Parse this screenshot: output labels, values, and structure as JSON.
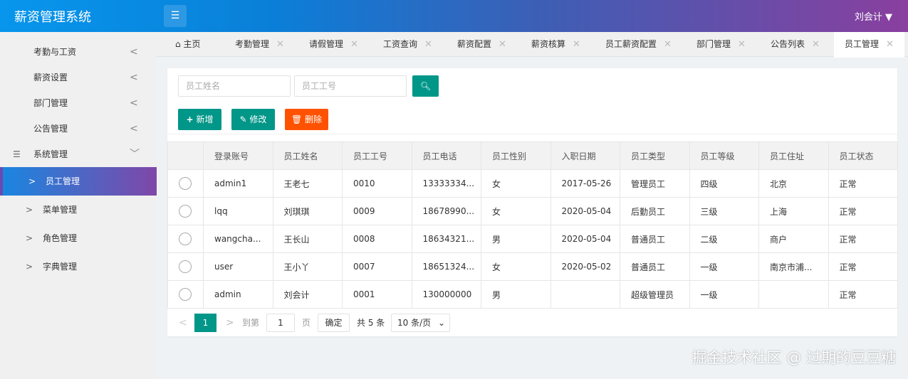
{
  "header": {
    "title": "薪资管理系统",
    "user": "刘会计"
  },
  "sidebar": {
    "items": [
      {
        "label": "考勤与工资"
      },
      {
        "label": "薪资设置"
      },
      {
        "label": "部门管理"
      },
      {
        "label": "公告管理"
      },
      {
        "label": "系统管理"
      }
    ],
    "sub": [
      {
        "label": "员工管理",
        "active": true
      },
      {
        "label": "菜单管理"
      },
      {
        "label": "角色管理"
      },
      {
        "label": "字典管理"
      }
    ]
  },
  "tabs": [
    {
      "label": "主页"
    },
    {
      "label": "考勤管理"
    },
    {
      "label": "请假管理"
    },
    {
      "label": "工资查询"
    },
    {
      "label": "薪资配置"
    },
    {
      "label": "薪资核算"
    },
    {
      "label": "员工薪资配置"
    },
    {
      "label": "部门管理"
    },
    {
      "label": "公告列表"
    },
    {
      "label": "员工管理",
      "active": true
    }
  ],
  "search": {
    "name_placeholder": "员工姓名",
    "id_placeholder": "员工工号"
  },
  "toolbar": {
    "add": "新增",
    "edit": "修改",
    "delete": "删除"
  },
  "table": {
    "headers": [
      "登录账号",
      "员工姓名",
      "员工工号",
      "员工电话",
      "员工性别",
      "入职日期",
      "员工类型",
      "员工等级",
      "员工住址",
      "员工状态"
    ],
    "rows": [
      [
        "admin1",
        "王老七",
        "0010",
        "13333334...",
        "女",
        "2017-05-26",
        "管理员工",
        "四级",
        "北京",
        "正常"
      ],
      [
        "lqq",
        "刘琪琪",
        "0009",
        "18678990...",
        "女",
        "2020-05-04",
        "后勤员工",
        "三级",
        "上海",
        "正常"
      ],
      [
        "wangcha...",
        "王长山",
        "0008",
        "18634321...",
        "男",
        "2020-05-04",
        "普通员工",
        "二级",
        "商户",
        "正常"
      ],
      [
        "user",
        "王小丫",
        "0007",
        "18651324...",
        "女",
        "2020-05-02",
        "普通员工",
        "一级",
        "南京市浦...",
        "正常"
      ],
      [
        "admin",
        "刘会计",
        "0001",
        "130000000",
        "男",
        "",
        "超级管理员",
        "一级",
        "",
        "正常"
      ]
    ]
  },
  "pager": {
    "current": "1",
    "goto": "到第",
    "page_input": "1",
    "page_unit": "页",
    "confirm": "确定",
    "total": "共 5 条",
    "size": "10 条/页"
  },
  "watermark": "掘金技术社区 @ 过期的豆豆糖"
}
